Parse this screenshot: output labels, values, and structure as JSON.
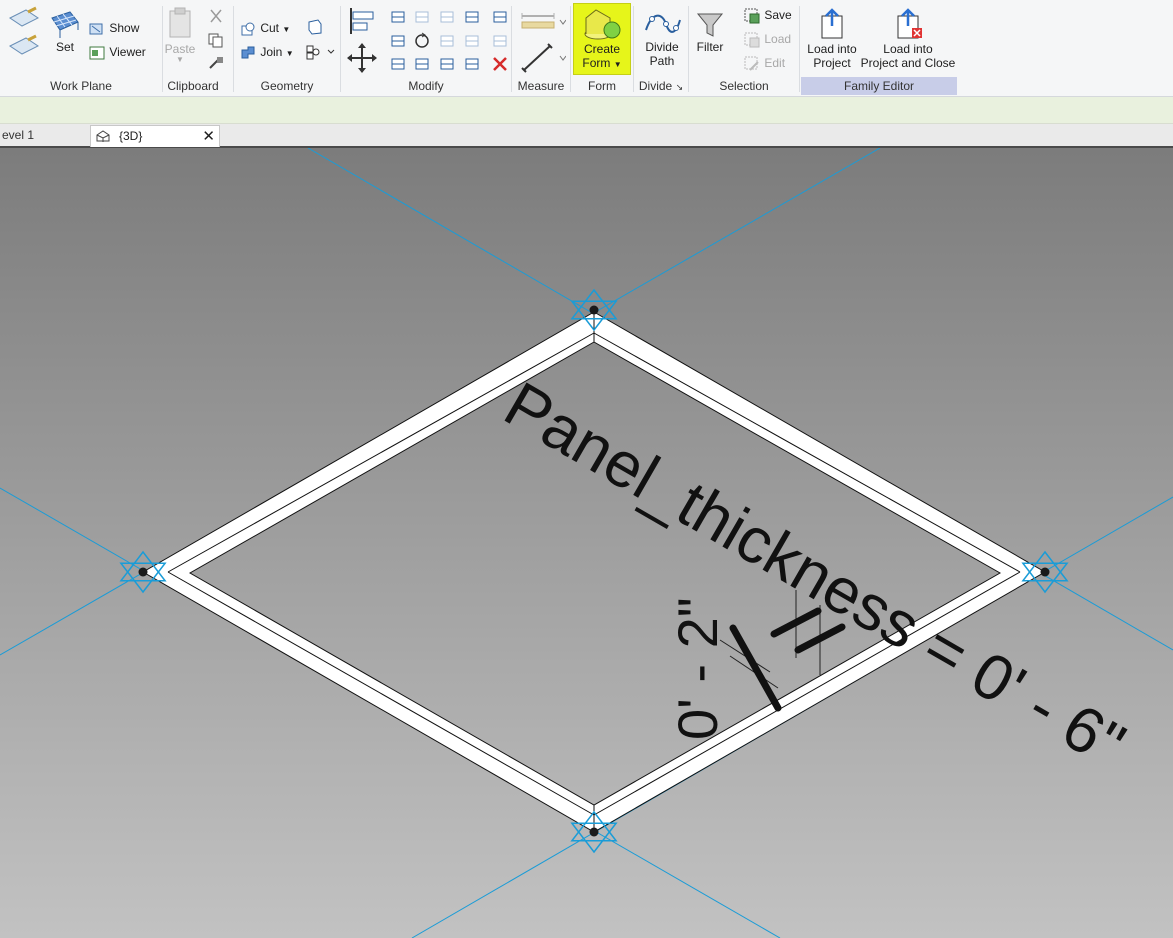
{
  "ribbon": {
    "workplane": {
      "set": "Set",
      "show": "Show",
      "viewer": "Viewer",
      "label": "Work Plane"
    },
    "clipboard": {
      "paste": "Paste",
      "label": "Clipboard"
    },
    "geometry": {
      "cut": "Cut",
      "join": "Join",
      "label": "Geometry"
    },
    "modify": {
      "label": "Modify"
    },
    "measure": {
      "label": "Measure"
    },
    "form": {
      "create_line1": "Create",
      "create_line2": "Form",
      "label": "Form"
    },
    "divide": {
      "path_line1": "Divide",
      "path_line2": "Path",
      "label": "Divide"
    },
    "selection": {
      "filter": "Filter",
      "save": "Save",
      "load": "Load",
      "edit": "Edit",
      "label": "Selection"
    },
    "family_editor": {
      "load_line1": "Load into",
      "load_line2": "Project",
      "loadclose_line1": "Load into",
      "loadclose_line2": "Project and Close",
      "label": "Family Editor"
    }
  },
  "tabs": {
    "level": "evel 1",
    "view3d": "{3D}"
  },
  "viewport": {
    "param_text": "Panel_thickness = 0' - 6\"",
    "dim_text": "0' - 2\"",
    "colors": {
      "highlight": "#e6f51a",
      "reference": "#1a9cd7"
    }
  }
}
